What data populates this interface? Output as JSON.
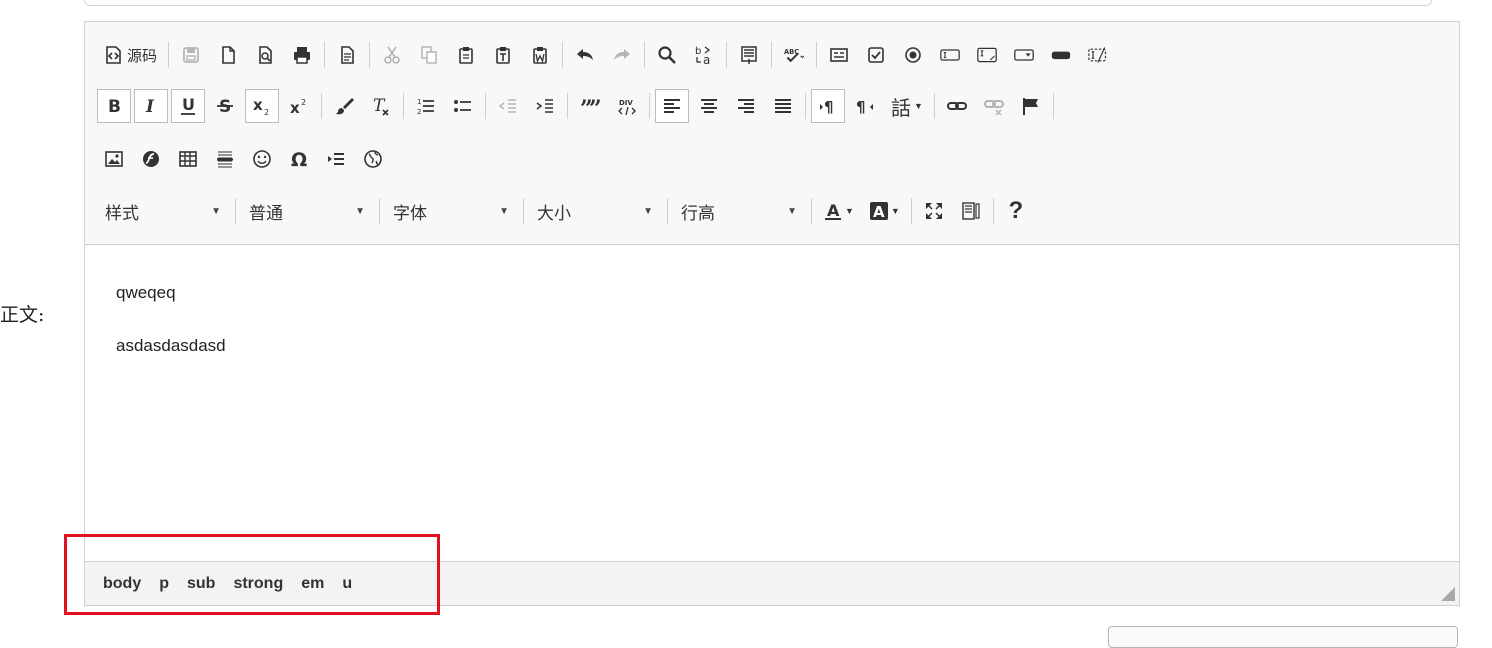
{
  "form": {
    "label": "正文:"
  },
  "toolbar": {
    "source_label": "源码",
    "styles_combo": "样式",
    "format_combo": "普通",
    "font_combo": "字体",
    "size_combo": "大小",
    "lineheight_combo": "行高",
    "spellcheck_label": "ABC",
    "language_label": "話",
    "text_color_label": "A",
    "bg_color_label": "A",
    "div_label": "DIV",
    "help_label": "?",
    "colors": {
      "active_border": "#bcbcbc",
      "disabled": "#b5b5b5"
    }
  },
  "content": {
    "paragraphs": [
      "qweqeq",
      "asdasdasdasd"
    ]
  },
  "statusbar": {
    "path": [
      "body",
      "p",
      "sub",
      "strong",
      "em",
      "u"
    ]
  },
  "annotation": {
    "color": "#e3101f"
  }
}
